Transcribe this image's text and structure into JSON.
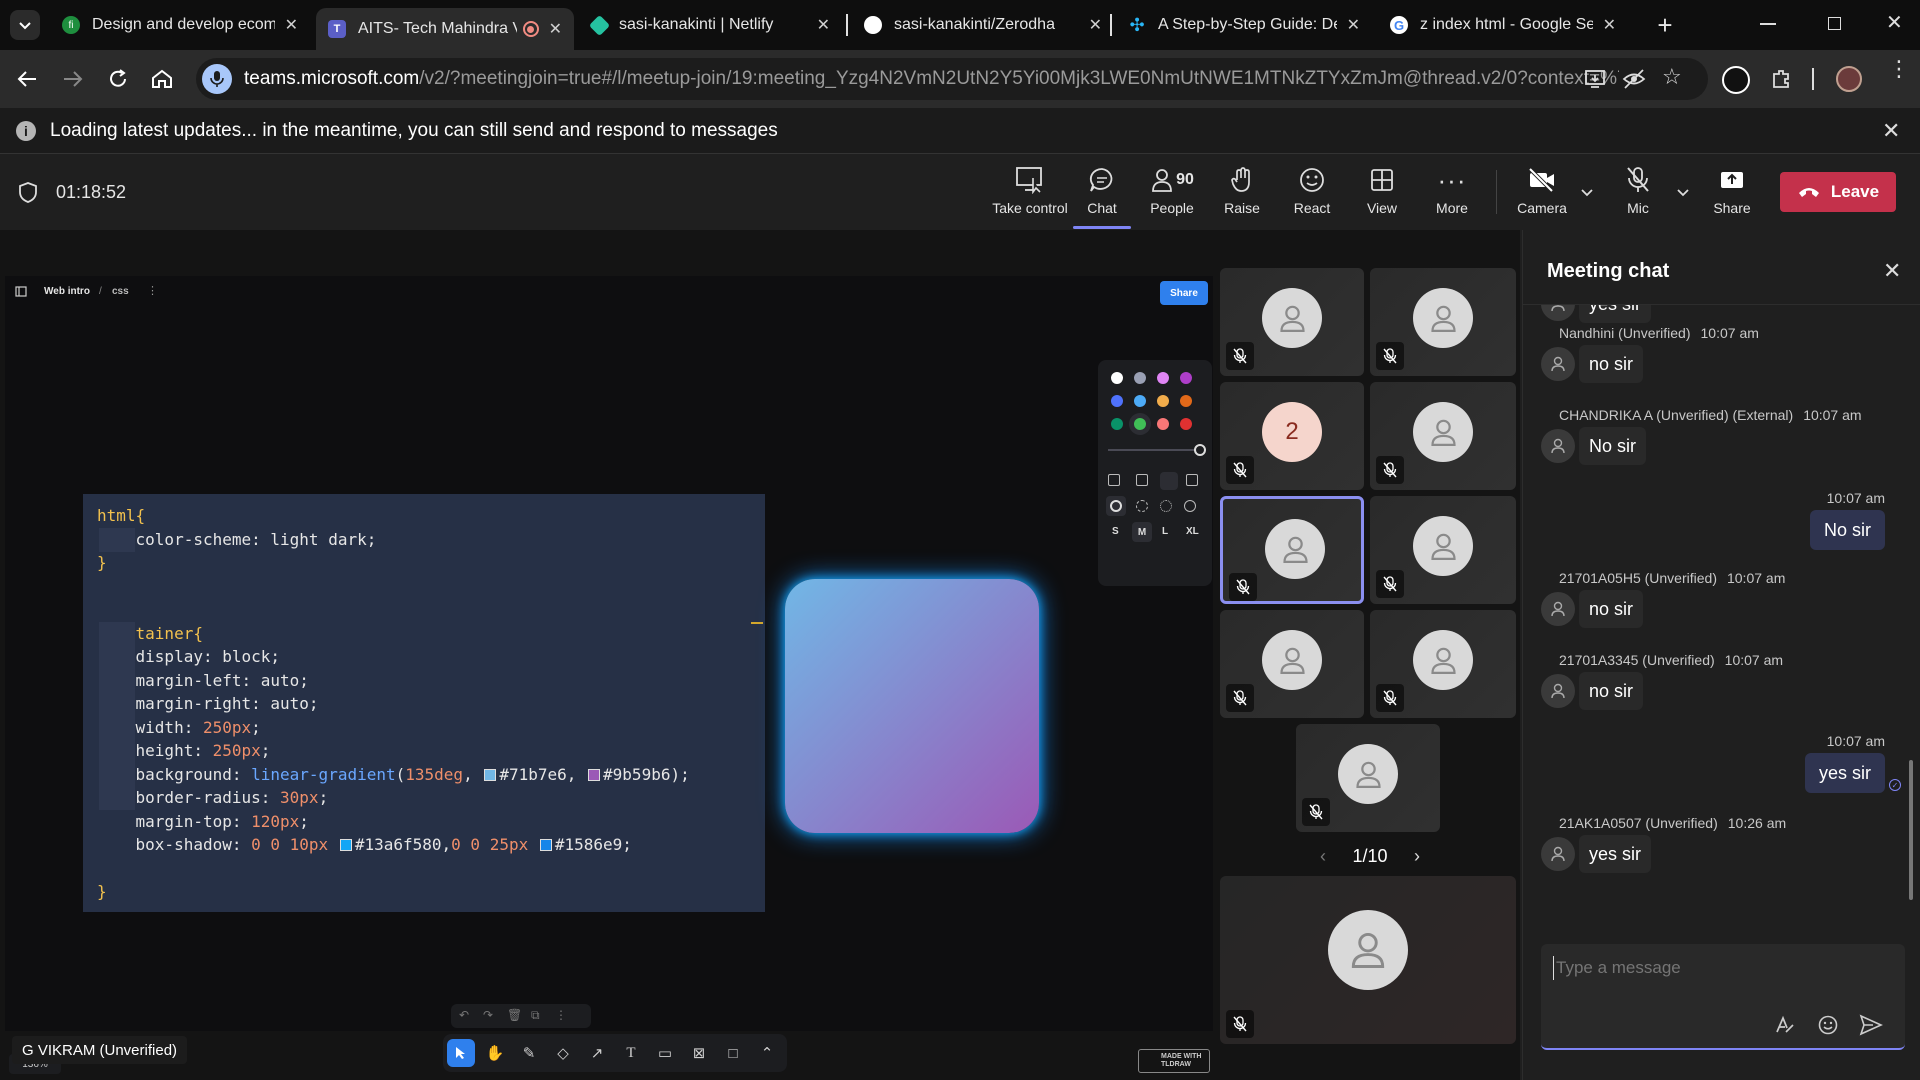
{
  "browser": {
    "tabs": [
      {
        "title": "Design and develop ecomr",
        "color": "#1e8e3e",
        "glyph": "fi"
      },
      {
        "title": "AITS- Tech Mahindra V",
        "color": "#5b5fc7",
        "glyph": "T",
        "active": true
      },
      {
        "title": "sasi-kanakinti | Netlify",
        "color": "#25c2a0",
        "glyph": "◆"
      },
      {
        "title": "sasi-kanakinti/Zerodha",
        "color": "#ffffff",
        "glyph": "●"
      },
      {
        "title": "A Step-by-Step Guide: Dep",
        "color": "#29b6f6",
        "glyph": "✣"
      },
      {
        "title": "z index html - Google Sear",
        "color": "#4285f4",
        "glyph": "G"
      }
    ],
    "url_host": "teams.microsoft.com",
    "url_path": "/v2/?meetingjoin=true#/l/meetup-join/19:meeting_Yzg4N2VmN2UtN2Y5Yi00Mjk3LWE0NmUtNWE1MTNkZTYxZmJm@thread.v2/0?context=%7b\"Tid...",
    "info_message": "Loading latest updates... in the meantime, you can still send and respond to messages"
  },
  "meeting": {
    "timer": "01:18:52",
    "people_count": "90",
    "buttons": {
      "take_control": "Take control",
      "chat": "Chat",
      "people": "People",
      "raise": "Raise",
      "react": "React",
      "view": "View",
      "more": "More",
      "camera": "Camera",
      "mic": "Mic",
      "share": "Share",
      "leave": "Leave"
    }
  },
  "whiteboard": {
    "breadcrumb_page": "Web intro",
    "breadcrumb_sub": "css",
    "share_label": "Share",
    "zoom": "136%",
    "size_options": [
      "S",
      "M",
      "L",
      "XL"
    ],
    "made_with": "MADE WITH TLDRAW",
    "colors": [
      "#ffffff",
      "#9aa0b4",
      "#e085f4",
      "#ae3ec9",
      "#4f72fc",
      "#4dabf7",
      "#f1ac4b",
      "#e16919",
      "#099268",
      "#40c057",
      "#f87777",
      "#e03131"
    ],
    "code_lines": [
      "html{",
      "    color-scheme: light dark;",
      "}",
      "",
      "",
      ".container{",
      "    display: block;",
      "    margin-left: auto;",
      "    margin-right: auto;",
      "    width: 250px;",
      "    height: 250px;",
      "    background: linear-gradient(135deg,  #71b7e6,  #9b59b6);",
      "    border-radius: 30px;",
      "    margin-top: 120px;",
      "    box-shadow: 0 0 10px  #13a6f580,0 0 25px  #1586e9;",
      "",
      "}"
    ],
    "presenter": "G VIKRAM (Unverified)"
  },
  "participants": {
    "badge_number": "2",
    "pagination": "1/10"
  },
  "chat": {
    "title": "Meeting chat",
    "cut_top_text": "yes sir",
    "messages": [
      {
        "sender": "Nandhini (Unverified)",
        "time": "10:07 am",
        "text": "no sir"
      },
      {
        "sender": "CHANDRIKA A (Unverified) (External)",
        "time": "10:07 am",
        "text": "No sir"
      },
      {
        "mine": true,
        "time": "10:07 am",
        "text": "No sir"
      },
      {
        "sender": "21701A05H5 (Unverified)",
        "time": "10:07 am",
        "text": "no sir"
      },
      {
        "sender": "21701A3345 (Unverified)",
        "time": "10:07 am",
        "text": "no sir"
      },
      {
        "mine": true,
        "time": "10:07 am",
        "text": "yes sir"
      },
      {
        "sender": "21AK1A0507 (Unverified)",
        "time": "10:26 am",
        "text": "yes sir"
      }
    ],
    "compose_placeholder": "Type a message"
  }
}
